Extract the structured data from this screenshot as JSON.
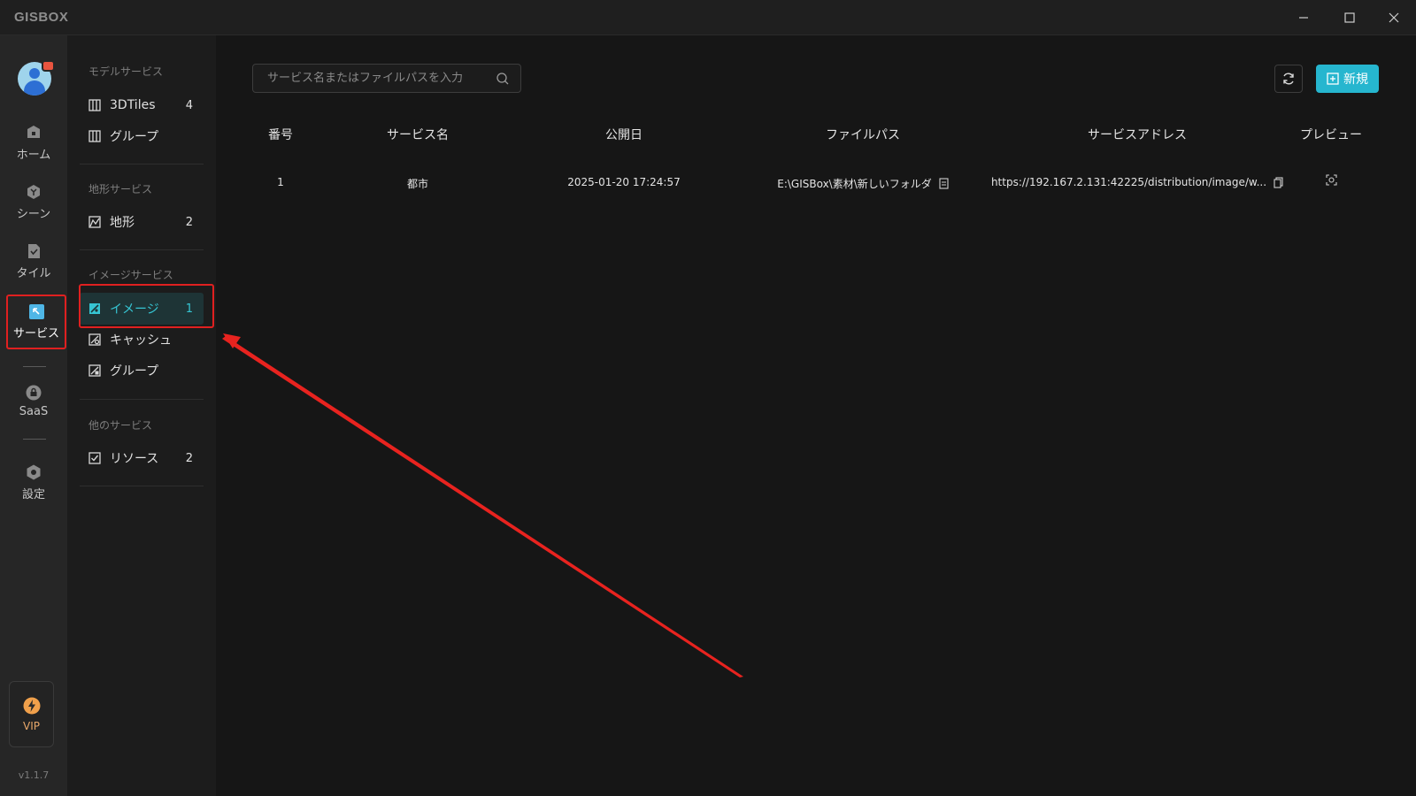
{
  "app": {
    "logo_text": "GISBOX",
    "version": "v1.1.7"
  },
  "window_controls": [
    "minimize",
    "maximize",
    "close"
  ],
  "rail": {
    "items": [
      {
        "label": "ホーム",
        "icon": "home-icon"
      },
      {
        "label": "シーン",
        "icon": "cube-icon"
      },
      {
        "label": "タイル",
        "icon": "tile-icon"
      },
      {
        "label": "サービス",
        "icon": "service-icon",
        "active": true
      },
      {
        "label": "SaaS",
        "icon": "lock-icon"
      },
      {
        "label": "設定",
        "icon": "gear-icon"
      }
    ],
    "vip_label": "VIP"
  },
  "subnav": {
    "sections": [
      {
        "title": "モデルサービス",
        "items": [
          {
            "label": "3DTiles",
            "count": "4"
          },
          {
            "label": "グループ",
            "count": ""
          }
        ]
      },
      {
        "title": "地形サービス",
        "items": [
          {
            "label": "地形",
            "count": "2"
          }
        ]
      },
      {
        "title": "イメージサービス",
        "items": [
          {
            "label": "イメージ",
            "count": "1",
            "active": true
          },
          {
            "label": "キャッシュ",
            "count": ""
          },
          {
            "label": "グループ",
            "count": ""
          }
        ]
      },
      {
        "title": "他のサービス",
        "items": [
          {
            "label": "リソース",
            "count": "2"
          }
        ]
      }
    ]
  },
  "toolbar": {
    "search_placeholder": "サービス名またはファイルパスを入力",
    "new_label": "新規"
  },
  "table": {
    "headers": [
      "番号",
      "サービス名",
      "公開日",
      "ファイルパス",
      "サービスアドレス",
      "プレビュー"
    ],
    "rows": [
      {
        "no": "1",
        "name": "都市",
        "date": "2025-01-20 17:24:57",
        "path": "E:\\GISBox\\素材\\新しいフォルダ",
        "address": "https://192.167.2.131:42225/distribution/image/w..."
      }
    ]
  },
  "colors": {
    "accent": "#26b6cf",
    "active_text": "#36c5d3",
    "highlight": "#e02020",
    "vip": "#e8a86a"
  }
}
